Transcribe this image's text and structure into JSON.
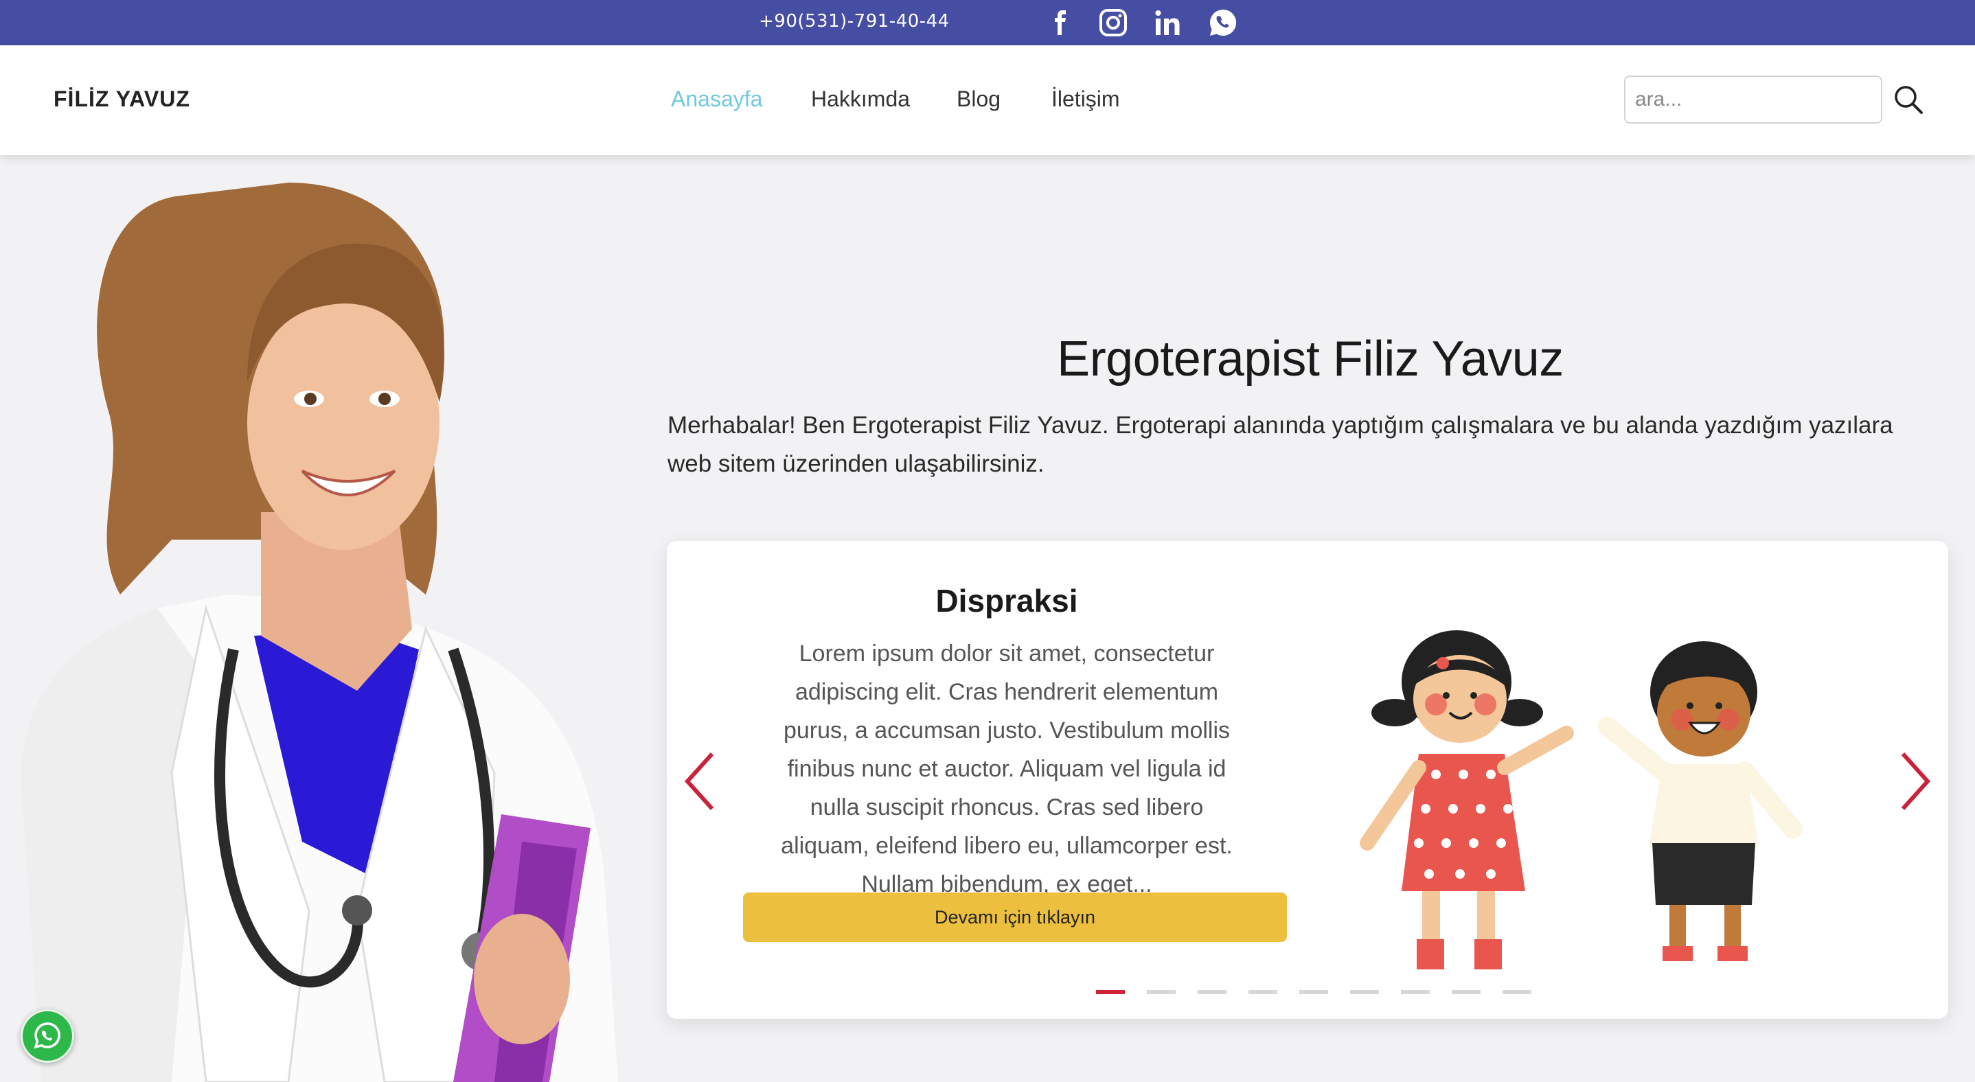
{
  "topbar": {
    "phone": "+90(531)-791-40-44",
    "social_icons": [
      "facebook-icon",
      "instagram-icon",
      "linkedin-icon",
      "whatsapp-icon"
    ],
    "bg_color": "#454ea3"
  },
  "nav": {
    "brand": "FİLİZ YAVUZ",
    "links": [
      {
        "label": "Anasayfa",
        "active": true
      },
      {
        "label": "Hakkımda",
        "active": false
      },
      {
        "label": "Blog",
        "active": false
      },
      {
        "label": "İletişim",
        "active": false
      }
    ],
    "search_placeholder": "ara...",
    "active_color": "#6ec9df"
  },
  "hero": {
    "title": "Ergoterapist Filiz Yavuz",
    "text": "Merhabalar! Ben Ergoterapist Filiz Yavuz. Ergoterapi alanında yaptığım çalışmalara ve bu alanda yazdığım yazılara web sitem üzerinden ulaşabilirsiniz."
  },
  "carousel": {
    "title": "Dispraksi",
    "text": "Lorem ipsum dolor sit amet, consectetur adipiscing elit. Cras hendrerit elementum purus, a accumsan justo. Vestibulum mollis finibus nunc et auctor. Aliquam vel ligula id nulla suscipit rhoncus. Cras sed libero aliquam, eleifend libero eu, ullamcorper est. Nullam bibendum, ex eget...",
    "button": "Devamı için tıklayın",
    "slide_count": 9,
    "active_slide": 1,
    "button_color": "#ecbf3e",
    "arrow_color": "#c8233a"
  }
}
